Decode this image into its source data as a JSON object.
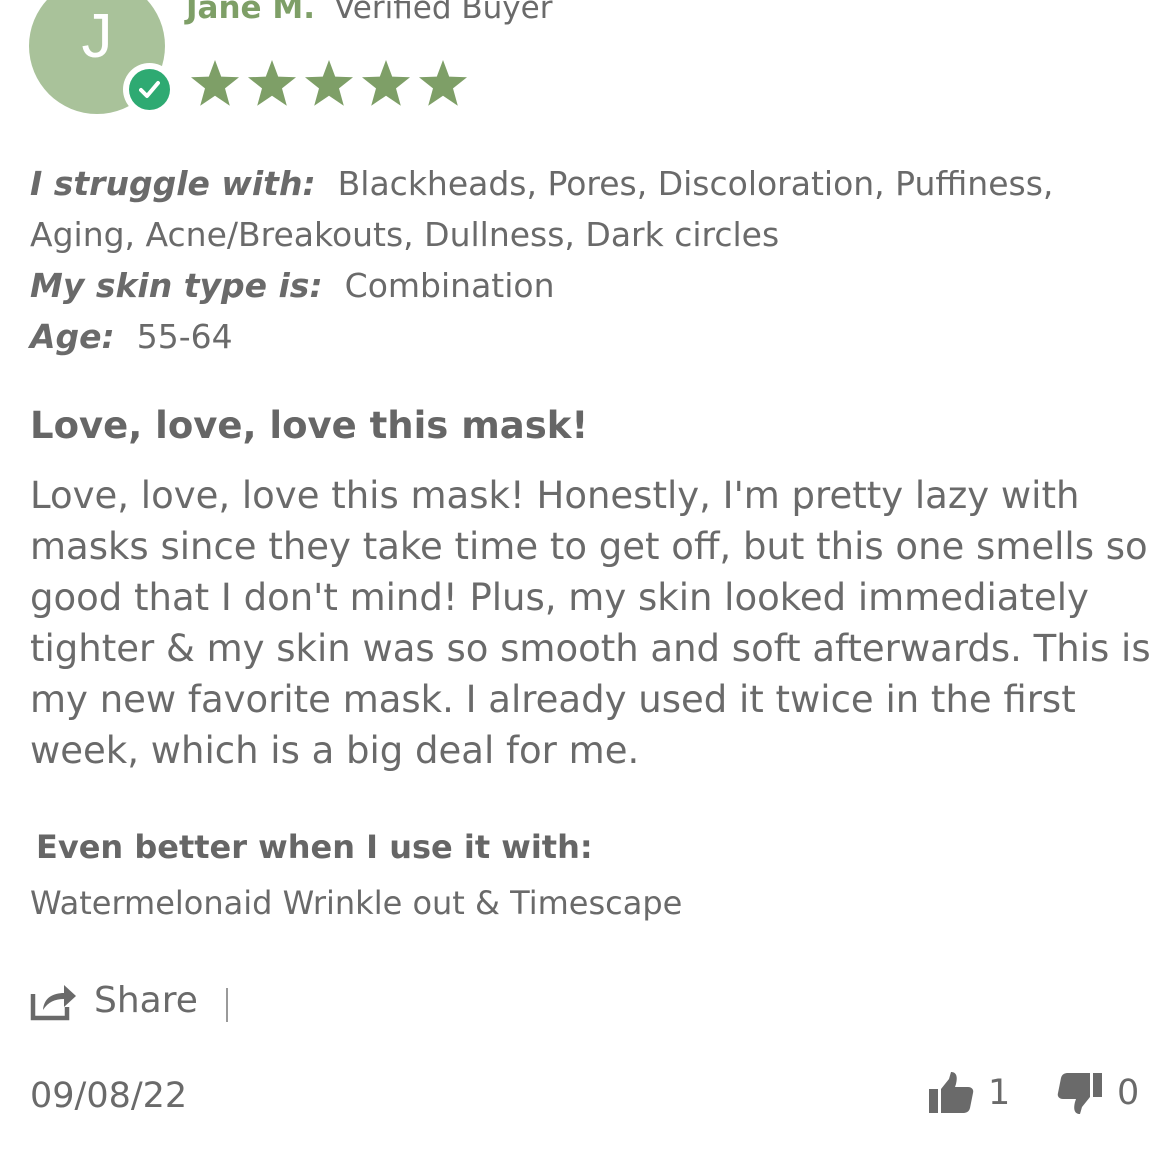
{
  "reviewer": {
    "initial": "J",
    "name": "Jane M.",
    "badge": "Verified Buyer",
    "rating": 5,
    "rating_max": 5,
    "colors": {
      "name": "#7e9f67",
      "avatar": "#a9c29a",
      "star": "#7e9f67",
      "verified": "#2eaa72"
    },
    "icons": [
      "verified-check-icon",
      "star-icon"
    ]
  },
  "profile": {
    "struggle_label": "I struggle with:",
    "struggle_value": "Blackheads, Pores, Discoloration, Puffiness, Aging, Acne/Breakouts, Dullness, Dark circles",
    "skin_type_label": "My skin type is:",
    "skin_type_value": "Combination",
    "age_label": "Age:",
    "age_value": "55-64"
  },
  "review": {
    "title": "Love, love, love this mask!",
    "body": "Love, love, love this mask! Honestly, I'm pretty lazy with masks since they take time to get off, but this one smells so good that I don't mind! Plus, my skin looked immediately tighter & my skin was so smooth and soft afterwards. This is my new favorite mask. I already used it twice in the first week, which is a big deal for me."
  },
  "better_with": {
    "title": "Even better when I use it with:",
    "products": "Watermelonaid Wrinkle out & Timescape"
  },
  "actions": {
    "share_label": "Share",
    "share_icon": "share-icon"
  },
  "footer": {
    "date": "09/08/22",
    "thumbs_up_count": "1",
    "thumbs_down_count": "0",
    "icons": [
      "thumbs-up-icon",
      "thumbs-down-icon"
    ]
  }
}
